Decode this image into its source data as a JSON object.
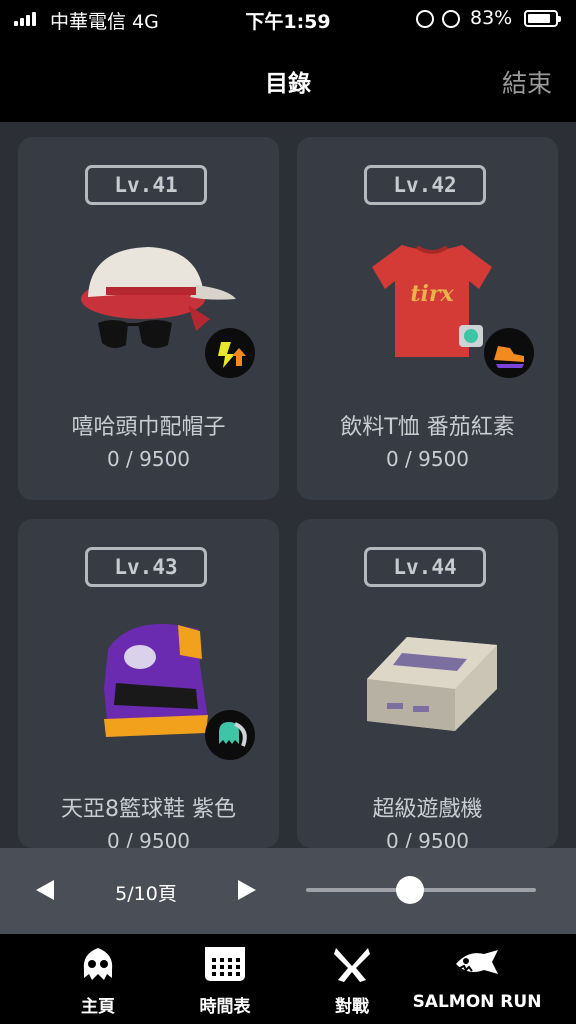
{
  "status_bar": {
    "carrier": "中華電信 4G",
    "time": "下午1:59",
    "battery": "83%",
    "battery_level": 0.83
  },
  "nav": {
    "title": "目錄",
    "done_label": "結束"
  },
  "items": [
    {
      "level": "Lv.41",
      "name": "嘻哈頭巾配帽子",
      "progress": "0 / 9500"
    },
    {
      "level": "Lv.42",
      "name": "飲料T恤 番茄紅素",
      "progress": "0 / 9500"
    },
    {
      "level": "Lv.43",
      "name": "天亞8籃球鞋 紫色",
      "progress": "0 / 9500"
    },
    {
      "level": "Lv.44",
      "name": "超級遊戲機",
      "progress": "0 / 9500"
    }
  ],
  "pager": {
    "page_text": "5/10頁",
    "slider_position": 0.45
  },
  "tabs": [
    {
      "label": "主頁",
      "icon": "squid-icon"
    },
    {
      "label": "時間表",
      "icon": "calendar-icon"
    },
    {
      "label": "對戰",
      "icon": "crossed-weapons-icon"
    },
    {
      "label": "SALMON RUN",
      "icon": "salmon-icon"
    }
  ],
  "colors": {
    "background": "#2c2f36",
    "card": "#373b44",
    "accent_red": "#d43b36",
    "accent_purple": "#6a2bb0"
  }
}
